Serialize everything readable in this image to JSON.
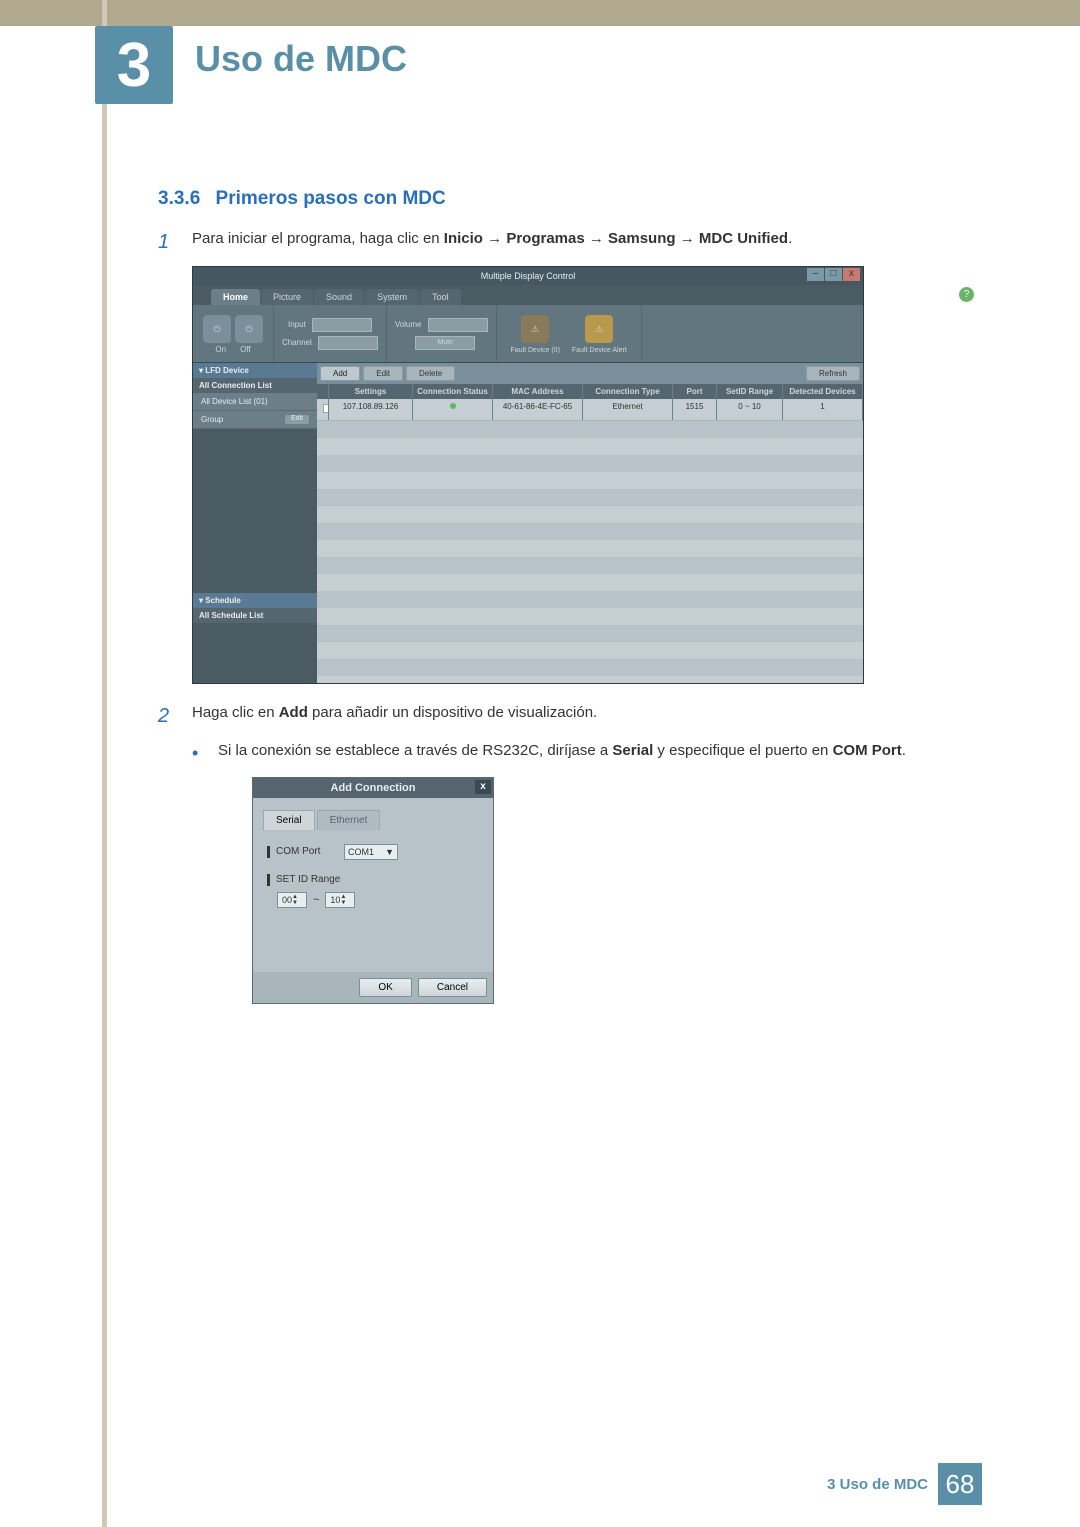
{
  "chapter": {
    "number": "3",
    "title": "Uso de MDC"
  },
  "section": {
    "number": "3.3.6",
    "title": "Primeros pasos con MDC"
  },
  "steps": {
    "s1": {
      "num": "1",
      "prefix": "Para iniciar el programa, haga clic en ",
      "b1": "Inicio",
      "arrow": " → ",
      "b2": "Programas",
      "b3": "Samsung",
      "b4": "MDC Unified",
      "suffix": "."
    },
    "s2": {
      "num": "2",
      "prefix": "Haga clic en ",
      "b1": "Add",
      "suffix": " para añadir un dispositivo de visualización."
    },
    "bullet1": {
      "text_a": "Si la conexión se establece a través de RS232C, diríjase a ",
      "b1": "Serial",
      "text_b": " y especifique el puerto en ",
      "b2": "COM Port",
      "text_c": "."
    }
  },
  "app": {
    "title": "Multiple Display Control",
    "tabs": [
      "Home",
      "Picture",
      "Sound",
      "System",
      "Tool"
    ],
    "ribbon": {
      "input_label": "Input",
      "channel_label": "Channel",
      "volume_label": "Volume",
      "mute_label": "Mute",
      "on": "On",
      "off": "Off",
      "fault0": "Fault Device (0)",
      "fault_alert": "Fault Device Alert"
    },
    "sidebar": {
      "lfd": "▾ LFD Device",
      "all_conn": "All Connection List",
      "all_dev": "All Device List (01)",
      "group": "Group",
      "edit": "Edit",
      "schedule": "▾ Schedule",
      "all_sched": "All Schedule List"
    },
    "toolbar": {
      "add": "Add",
      "edit": "Edit",
      "delete": "Delete",
      "refresh": "Refresh"
    },
    "columns": {
      "settings": "Settings",
      "conn_status": "Connection Status",
      "mac": "MAC Address",
      "conn_type": "Connection Type",
      "port": "Port",
      "setid": "SetID Range",
      "detected": "Detected Devices"
    },
    "row": {
      "settings": "107.108.89.126",
      "mac": "40-61-86-4E-FC-65",
      "conn_type": "Ethernet",
      "port": "1515",
      "setid": "0 ~ 10",
      "detected": "1"
    }
  },
  "dialog": {
    "title": "Add Connection",
    "tab_serial": "Serial",
    "tab_ethernet": "Ethernet",
    "com_port": "COM Port",
    "com_value": "COM1",
    "setid": "SET ID Range",
    "range_from": "00",
    "range_to": "10",
    "ok": "OK",
    "cancel": "Cancel"
  },
  "footer": {
    "text": "3 Uso de MDC",
    "page": "68"
  }
}
